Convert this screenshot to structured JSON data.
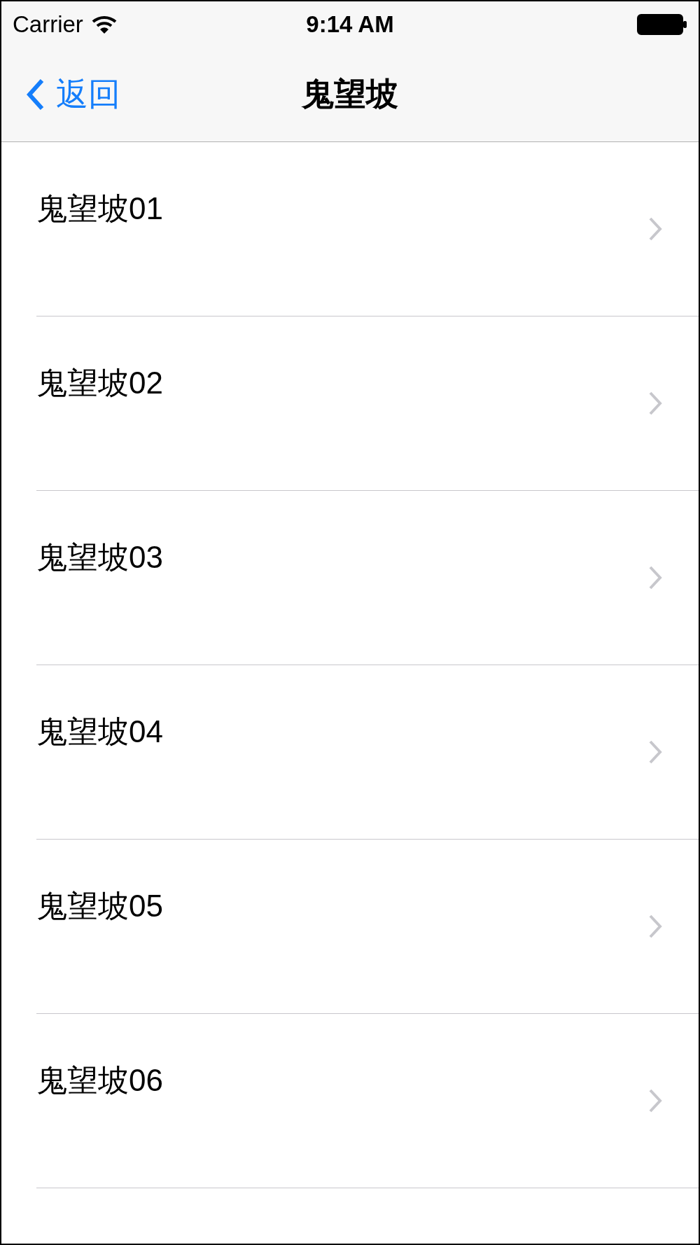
{
  "status_bar": {
    "carrier": "Carrier",
    "time": "9:14 AM"
  },
  "nav_bar": {
    "back": "返回",
    "title": "鬼望坡"
  },
  "list": [
    {
      "label": "鬼望坡01"
    },
    {
      "label": "鬼望坡02"
    },
    {
      "label": "鬼望坡03"
    },
    {
      "label": "鬼望坡04"
    },
    {
      "label": "鬼望坡05"
    },
    {
      "label": "鬼望坡06"
    }
  ]
}
